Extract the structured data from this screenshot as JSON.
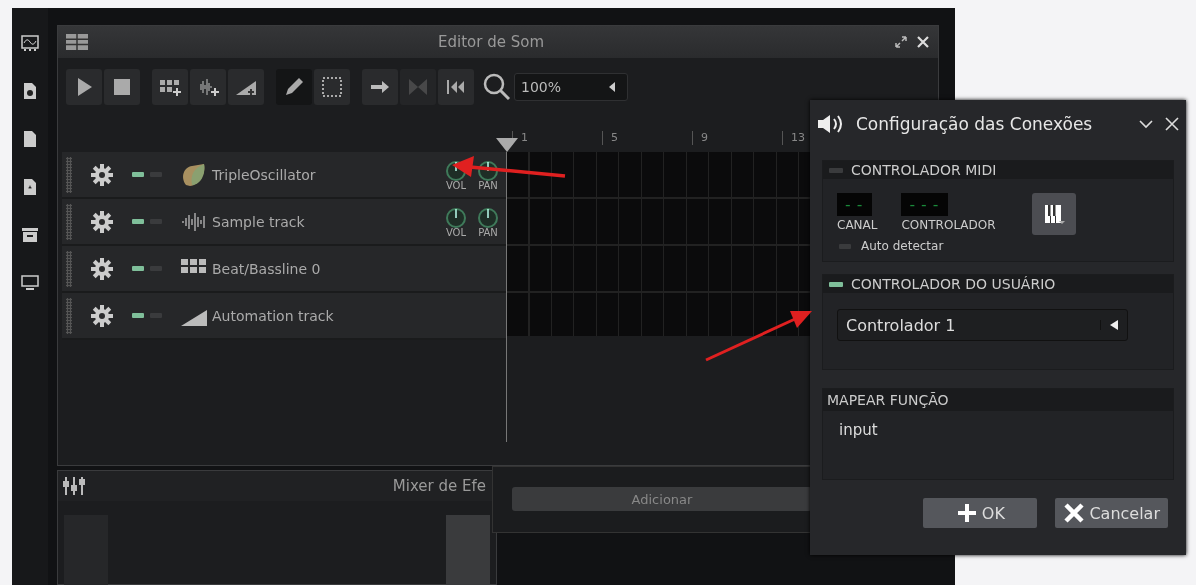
{
  "sidebar": {
    "items": [
      {
        "kind": "oscilloscope"
      },
      {
        "kind": "file-audio"
      },
      {
        "kind": "file"
      },
      {
        "kind": "file-star"
      },
      {
        "kind": "drawer"
      },
      {
        "kind": "monitor"
      }
    ]
  },
  "editor": {
    "title": "Editor de Som",
    "toolbar": [
      {
        "kind": "play",
        "selected": false,
        "disabled": false
      },
      {
        "kind": "stop",
        "selected": false,
        "disabled": false
      },
      {
        "kind": "add-beat",
        "selected": false,
        "disabled": false
      },
      {
        "kind": "add-sample",
        "selected": false,
        "disabled": false
      },
      {
        "kind": "add-automation",
        "selected": false,
        "disabled": false
      },
      {
        "kind": "draw",
        "selected": true,
        "disabled": false
      },
      {
        "kind": "select",
        "selected": false,
        "disabled": false
      },
      {
        "kind": "arrow",
        "selected": false,
        "disabled": false
      },
      {
        "kind": "bowtie",
        "selected": false,
        "disabled": true
      },
      {
        "kind": "rewind",
        "selected": false,
        "disabled": false
      }
    ],
    "zoom": "100%",
    "ruler": [
      "1",
      "5",
      "9",
      "13"
    ],
    "tracks": [
      {
        "kind": "instrument",
        "name": "TripleOscillator",
        "muted": false,
        "solo": false,
        "knobs": [
          "VOL",
          "PAN"
        ]
      },
      {
        "kind": "sample",
        "name": "Sample track",
        "muted": false,
        "solo": false,
        "knobs": [
          "VOL",
          "PAN"
        ]
      },
      {
        "kind": "beat",
        "name": "Beat/Bassline 0",
        "muted": false,
        "solo": false
      },
      {
        "kind": "automation",
        "name": "Automation track",
        "muted": false,
        "solo": false
      }
    ]
  },
  "mixer": {
    "title": "Mixer de Efe"
  },
  "effects_panel": {
    "button": "Adicionar"
  },
  "dialog": {
    "title": "Configuração das Conexões",
    "midi": {
      "title": "CONTROLADOR MIDI",
      "enabled": false,
      "channel_display": "--",
      "channel_label": "CANAL",
      "controller_display": "---",
      "controller_label": "CONTROLADOR",
      "auto_detect": {
        "label": "Auto detectar",
        "checked": false
      }
    },
    "user": {
      "title": "CONTROLADOR DO USUÁRIO",
      "enabled": true,
      "value": "Controlador 1"
    },
    "mapping": {
      "title": "MAPEAR FUNÇÃO",
      "value": "input"
    },
    "buttons": [
      {
        "kind": "ok",
        "label": "OK"
      },
      {
        "kind": "cancel",
        "label": "Cancelar"
      }
    ]
  }
}
